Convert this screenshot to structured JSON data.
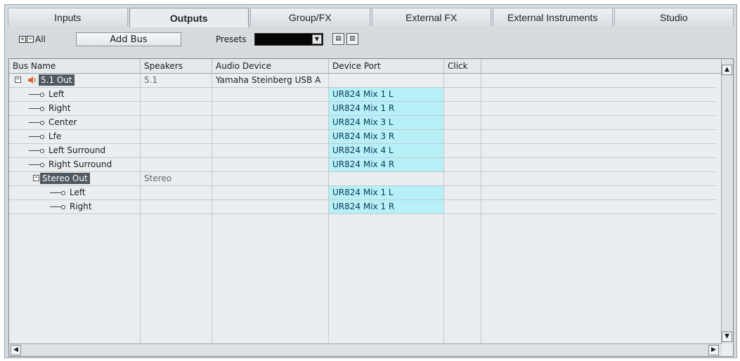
{
  "tabs": [
    {
      "label": "Inputs",
      "active": false
    },
    {
      "label": "Outputs",
      "active": true
    },
    {
      "label": "Group/FX",
      "active": false
    },
    {
      "label": "External FX",
      "active": false
    },
    {
      "label": "External Instruments",
      "active": false
    },
    {
      "label": "Studio",
      "active": false
    }
  ],
  "toolbar": {
    "expand_all_symbol": "+",
    "collapse_all_symbol": "−",
    "all_label": "All",
    "add_bus_label": "Add Bus",
    "presets_label": "Presets"
  },
  "columns": [
    "Bus Name",
    "Speakers",
    "Audio Device",
    "Device Port",
    "Click"
  ],
  "buses": [
    {
      "name": "5.1 Out",
      "speakers": "5.1",
      "audio_device": "Yamaha Steinberg USB A",
      "channels": [
        {
          "name": "Left",
          "port": "UR824 Mix 1 L"
        },
        {
          "name": "Right",
          "port": "UR824 Mix 1 R"
        },
        {
          "name": "Center",
          "port": "UR824 Mix 3 L"
        },
        {
          "name": "Lfe",
          "port": "UR824 Mix 3 R"
        },
        {
          "name": "Left Surround",
          "port": "UR824 Mix 4 L"
        },
        {
          "name": "Right Surround",
          "port": "UR824 Mix 4 R"
        }
      ]
    },
    {
      "name": "Stereo Out",
      "speakers": "Stereo",
      "audio_device": "",
      "channels": [
        {
          "name": "Left",
          "port": "UR824 Mix 1 L"
        },
        {
          "name": "Right",
          "port": "UR824 Mix 1 R"
        }
      ]
    }
  ],
  "colors": {
    "port_highlight": "#b8f0f7",
    "bus_label_bg": "#505860",
    "panel_bg": "#d6dbe0"
  }
}
